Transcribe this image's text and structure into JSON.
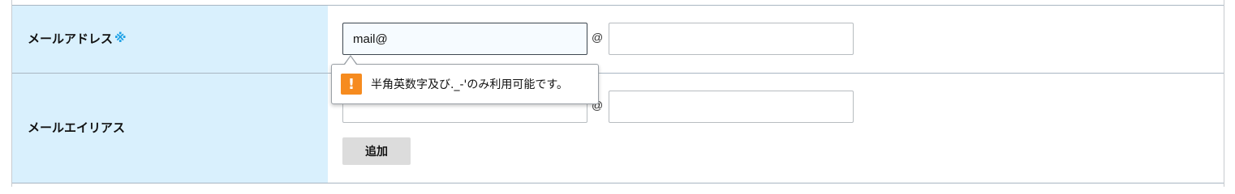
{
  "form": {
    "email_row": {
      "label": "メールアドレス",
      "required_mark": "※",
      "local_value": "mail@",
      "at_symbol": "@",
      "domain_value": ""
    },
    "alias_row": {
      "label": "メールエイリアス",
      "local_value": "",
      "at_symbol": "@",
      "domain_value": "",
      "add_button_label": "追加"
    }
  },
  "validation_tooltip": {
    "icon": "warning-icon",
    "icon_glyph": "!",
    "message": "半角英数字及び._-'のみ利用可能です。",
    "icon_color": "#f68b1f"
  },
  "colors": {
    "label_background": "#d9f0fd",
    "required_mark": "#1da1e6",
    "row_divider": "#a9b6c2"
  }
}
